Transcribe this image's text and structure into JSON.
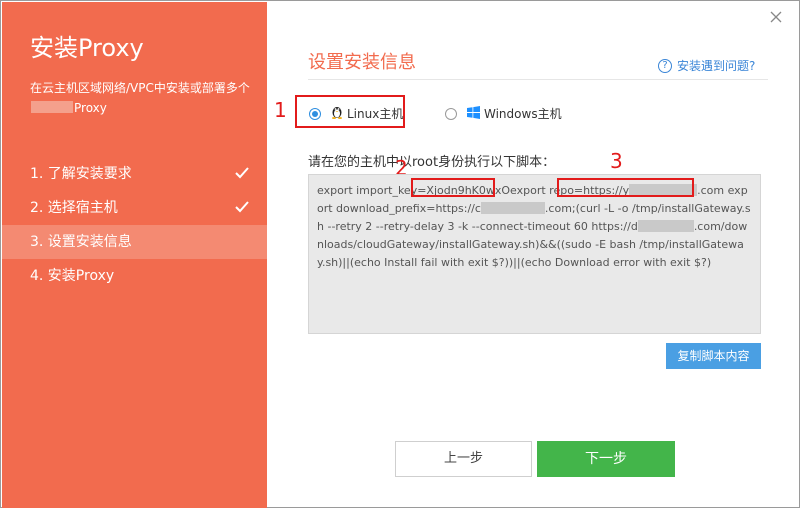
{
  "sidebar": {
    "title": "安装Proxy",
    "desc_prefix": "在云主机区域网络/VPC中安装或部署多个",
    "desc_suffix": "Proxy",
    "steps": [
      {
        "label": "1. 了解安装要求",
        "done": true
      },
      {
        "label": "2. 选择宿主机",
        "done": true
      },
      {
        "label": "3. 设置安装信息",
        "active": true
      },
      {
        "label": "4. 安装Proxy"
      }
    ]
  },
  "main": {
    "title": "设置安装信息",
    "help": "安装遇到问题?",
    "os_options": {
      "linux": "Linux主机",
      "windows": "Windows主机"
    },
    "instruction": "请在您的主机中以root身份执行以下脚本：",
    "script": {
      "p1": "export import_key=",
      "key": "Xjodn9hK0wxO",
      "p2": "export repo=",
      "repo_a": "https://y",
      "repo_b": ".com",
      "p3": "export download_prefix=https://c",
      "p4": ".com;(curl -L -o /tmp/installGateway.sh --retry 2 --retry-delay 3 -k --connect-timeout 60 https://d",
      "p5": ".com/downloads/cloudGateway/installGateway.sh)&&((sudo -E bash /tmp/installGateway.sh)||(echo Install fail with exit $?))||(echo Download error with exit $?)"
    },
    "copy_button": "复制脚本内容",
    "prev_button": "上一步",
    "next_button": "下一步"
  },
  "annotations": {
    "n1": "1",
    "n2": "2",
    "n3": "3"
  },
  "colors": {
    "sidebar": "#f26b4e",
    "accent_blue": "#4a9fe3",
    "next_green": "#43b54a",
    "annotation_red": "#e21b1b"
  }
}
